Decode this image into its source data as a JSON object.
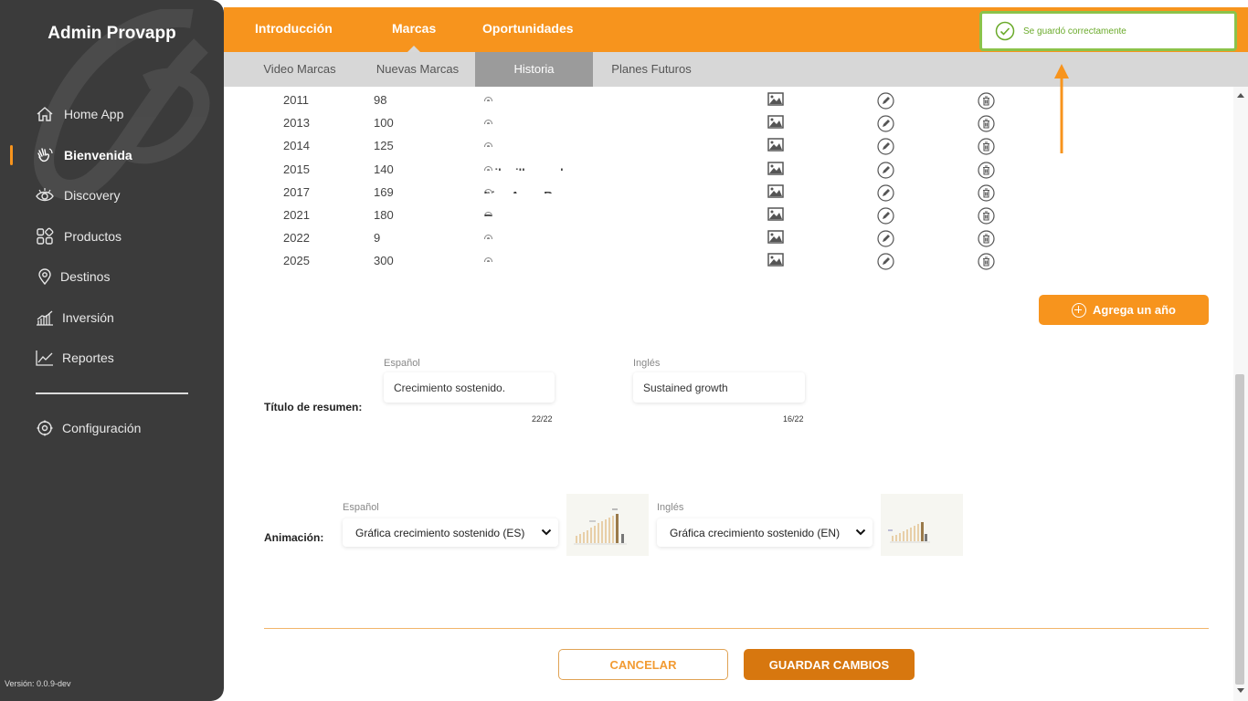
{
  "sidebar": {
    "brand": "Admin Provapp",
    "items": [
      {
        "label": "Home App",
        "icon": "home-icon"
      },
      {
        "label": "Bienvenida",
        "icon": "waving-hand-icon"
      },
      {
        "label": "Discovery",
        "icon": "eye-icon"
      },
      {
        "label": "Productos",
        "icon": "grid-icon"
      },
      {
        "label": "Destinos",
        "icon": "map-pin-icon"
      },
      {
        "label": "Inversión",
        "icon": "bar-chart-icon"
      },
      {
        "label": "Reportes",
        "icon": "line-chart-icon"
      },
      {
        "label": "Configuración",
        "icon": "gear-icon"
      }
    ],
    "active": "Bienvenida",
    "version": "Versión: 0.0.9-dev"
  },
  "tabs": {
    "main": [
      "Introducción",
      "Marcas",
      "Oportunidades"
    ],
    "main_active": "Marcas",
    "sub": [
      "Video Marcas",
      "Nuevas Marcas",
      "Historia",
      "Planes Futuros"
    ],
    "sub_active": "Historia"
  },
  "toast": {
    "message": "Se guardó correctamente",
    "accent": "#8bc34a"
  },
  "history_rows": [
    {
      "year": "2011",
      "value": "98",
      "description": "Lanzamiento del segundo producto v...",
      "bold": ""
    },
    {
      "year": "2013",
      "value": "100",
      "description": "Lanzamiento del tercer producto vac...",
      "bold": ""
    },
    {
      "year": "2014",
      "value": "125",
      "description": "Posadas coloca en el mercado la ma...",
      "bold": ""
    },
    {
      "year": "2015",
      "value": "140",
      "description": "Posadas rebasa los ",
      "bold": "mil millones de ..."
    },
    {
      "year": "2017",
      "value": "169",
      "description": "Apertura de residencias ",
      "bold": "Live Aqua R..."
    },
    {
      "year": "2021",
      "value": "180",
      "description": "Expansión al Caribe Internacional: ",
      "bold": "R..."
    },
    {
      "year": "2022",
      "value": "9",
      "description": "Prueba",
      "bold": ""
    },
    {
      "year": "2025",
      "value": "300",
      "description": "Meta para Grupo Posadas en 2025: t...",
      "bold": ""
    }
  ],
  "add_year_label": "Agrega un año",
  "summary": {
    "label": "Título de resumen:",
    "es_label": "Español",
    "en_label": "Inglés",
    "es_value": "Crecimiento sostenido.",
    "en_value": "Sustained growth",
    "es_count": "22/22",
    "en_count": "16/22"
  },
  "animation": {
    "label": "Animación:",
    "es_label": "Español",
    "en_label": "Inglés",
    "es_value": "Gráfica crecimiento sostenido (ES)",
    "en_value": "Gráfica crecimiento sostenido (EN)"
  },
  "buttons": {
    "cancel": "CANCELAR",
    "save": "GUARDAR CAMBIOS"
  },
  "colors": {
    "accent": "#f7941d",
    "sidebar": "#3b3b3b",
    "save": "#d7770f"
  }
}
